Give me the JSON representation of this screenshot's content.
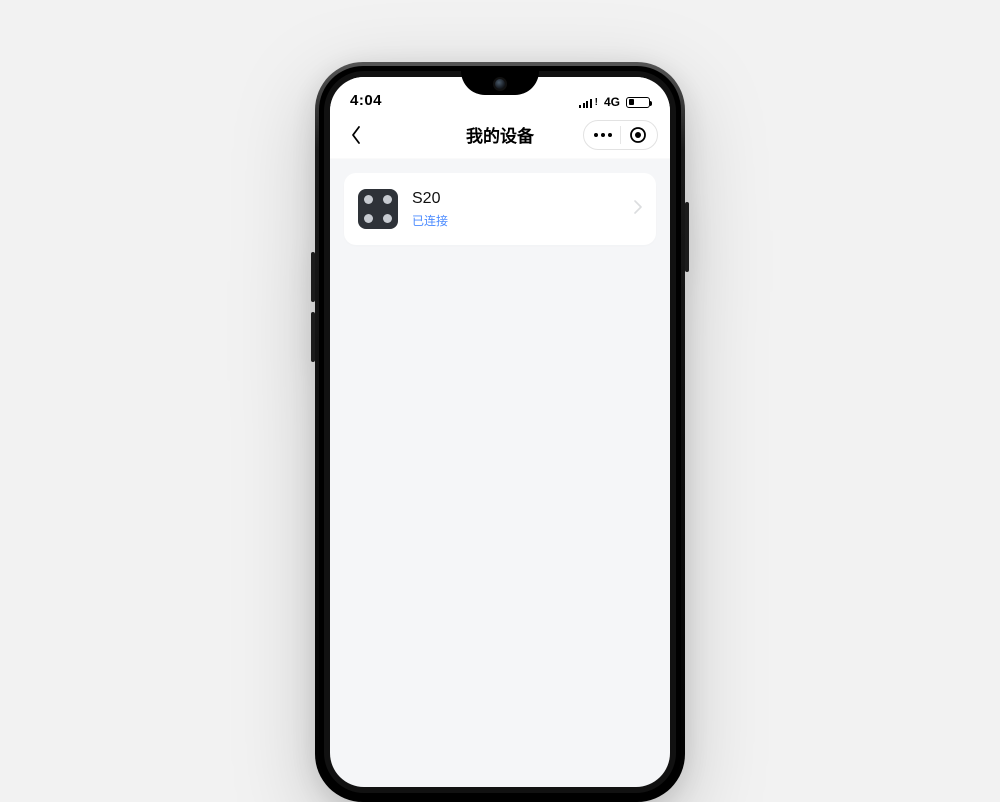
{
  "statusbar": {
    "time": "4:04",
    "network_label": "4G"
  },
  "header": {
    "title": "我的设备"
  },
  "devices": [
    {
      "name": "S20",
      "status": "已连接"
    }
  ],
  "colors": {
    "link": "#4b8bff",
    "screen_bg": "#f5f6f8"
  }
}
